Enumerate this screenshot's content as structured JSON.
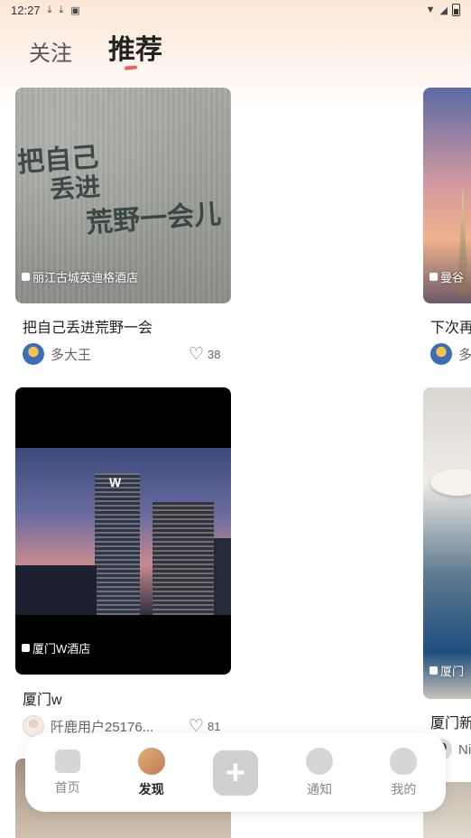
{
  "status_bar": {
    "time": "12:27"
  },
  "tabs": [
    {
      "label": "关注",
      "active": false
    },
    {
      "label": "推荐",
      "active": true
    }
  ],
  "feed": {
    "cards": [
      {
        "location": "丽江古城英迪格酒店",
        "title": "把自己丢进荒野一会",
        "author": "多大王",
        "likes": "38",
        "image_text": [
          "把自己",
          "丢进",
          "荒野一会儿"
        ]
      },
      {
        "location": "曼谷",
        "title": "下次再",
        "author": "多"
      },
      {
        "location": "厦门W酒店",
        "title": "厦门w",
        "author": "阡鹿用户25176...",
        "likes": "81",
        "image_logo": "W"
      },
      {
        "location": "厦门",
        "title": "厦门新",
        "author": "Ni"
      }
    ]
  },
  "bottom_nav": {
    "items": [
      {
        "label": "首页",
        "icon": "home-icon",
        "active": false
      },
      {
        "label": "发现",
        "icon": "discover-icon",
        "active": true
      },
      {
        "label": "+",
        "icon": "plus-icon"
      },
      {
        "label": "通知",
        "icon": "notification-icon",
        "active": false
      },
      {
        "label": "我的",
        "icon": "profile-icon",
        "active": false
      }
    ]
  },
  "colors": {
    "accent": "#e8625a",
    "header_gradient_top": "#fbe7d6"
  }
}
